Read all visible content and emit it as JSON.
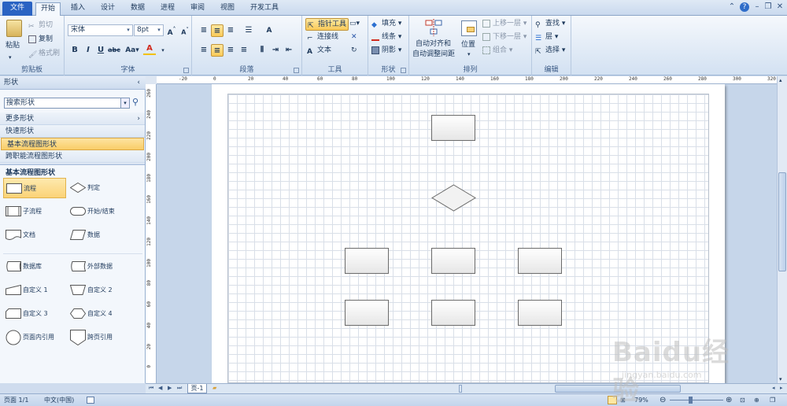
{
  "menu": {
    "tabs": [
      "文件",
      "开始",
      "插入",
      "设计",
      "数据",
      "进程",
      "审阅",
      "视图",
      "开发工具"
    ]
  },
  "ribbon": {
    "clipboard": {
      "paste": "粘贴",
      "cut": "剪切",
      "copy": "复制",
      "format_painter": "格式刷",
      "label": "剪贴板"
    },
    "font": {
      "family": "宋体",
      "size": "8pt",
      "label": "字体"
    },
    "paragraph": {
      "label": "段落"
    },
    "tools": {
      "pointer": "指针工具",
      "connector": "连接线",
      "text": "文本",
      "label": "工具"
    },
    "shape": {
      "fill": "填充",
      "line": "线条",
      "shadow": "阴影",
      "label": "形状"
    },
    "arrange": {
      "auto_align": "自动对齐和",
      "auto_space": "自动调整间距",
      "position": "位置",
      "bring_forward": "上移一层",
      "send_backward": "下移一层",
      "group": "组合",
      "label": "排列"
    },
    "edit": {
      "find": "查找",
      "layer": "层",
      "select": "选择",
      "label": "编辑"
    }
  },
  "shapes_panel": {
    "title": "形状",
    "search_placeholder": "搜索形状",
    "more_shapes": "更多形状",
    "quick_shapes": "快速形状",
    "basic_flowchart": "基本流程图形状",
    "cross_functional": "跨职能流程图形状",
    "stencil_title": "基本流程图形状",
    "items": [
      "流程",
      "判定",
      "子流程",
      "开始/结束",
      "文档",
      "数据",
      "数据库",
      "外部数据",
      "自定义 1",
      "自定义 2",
      "自定义 3",
      "自定义 4",
      "页面内引用",
      "跨页引用"
    ]
  },
  "rulers": {
    "h_labels": [
      "-20",
      "0",
      "20",
      "40",
      "60",
      "80",
      "100",
      "120",
      "140",
      "160",
      "180",
      "200",
      "220",
      "240",
      "260",
      "280",
      "300",
      "320"
    ],
    "v_labels": [
      "260",
      "240",
      "220",
      "200",
      "180",
      "160",
      "140",
      "120",
      "100",
      "80",
      "60",
      "40",
      "20",
      "0"
    ]
  },
  "pagebar": {
    "page_tab": "页-1"
  },
  "status": {
    "page": "页面 1/1",
    "language": "中文(中国)",
    "zoom": "79%"
  },
  "watermark": {
    "text": "Baidu经验",
    "url": "jingyan.baidu.com"
  },
  "colors": {
    "file_tab": "#2a63c3",
    "selected_item": "#f9cd68",
    "canvas_bg": "#c6d6ea"
  }
}
